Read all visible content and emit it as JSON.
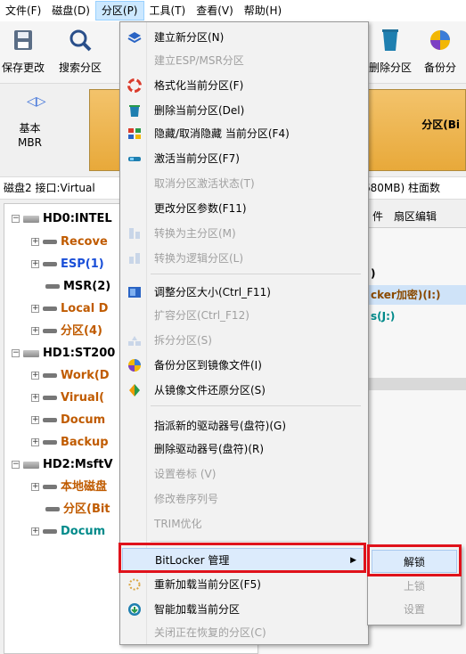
{
  "menubar": {
    "items": [
      {
        "label": "文件(F)"
      },
      {
        "label": "磁盘(D)"
      },
      {
        "label": "分区(P)"
      },
      {
        "label": "工具(T)"
      },
      {
        "label": "查看(V)"
      },
      {
        "label": "帮助(H)"
      }
    ]
  },
  "toolbar": {
    "save": "保存更改",
    "search": "搜索分区",
    "delete": "删除分区",
    "backup": "备份分"
  },
  "disk": {
    "type_line1": "基本",
    "type_line2": "MBR",
    "partition_label": "分区(Bi",
    "info_left": "磁盘2 接口:Virtual",
    "info_right": "680MB) 柱面数"
  },
  "tree": {
    "hd0": "HD0:INTEL",
    "recovery": "Recove",
    "esp": "ESP(1)",
    "msr": "MSR(2)",
    "local": "Local D",
    "part4": "分区(4)",
    "hd1": "HD1:ST200",
    "work": "Work(D",
    "virual": "Virual(",
    "docum1": "Docum",
    "backup": "Backup",
    "hd2": "HD2:MsftV",
    "local_disk": "本地磁盘",
    "part_bit": "分区(Bit",
    "docum2": "Docum"
  },
  "right_panel": {
    "tab1": "件",
    "tab2": "扇区编辑",
    "row1": ")",
    "row2": "cker加密)(I:)",
    "row3": "s(J:)"
  },
  "partition_menu": {
    "items": [
      {
        "label": "建立新分区(N)",
        "enabled": true
      },
      {
        "label": "建立ESP/MSR分区",
        "enabled": false
      },
      {
        "label": "格式化当前分区(F)",
        "enabled": true
      },
      {
        "label": "删除当前分区(Del)",
        "enabled": true
      },
      {
        "label": "隐藏/取消隐藏 当前分区(F4)",
        "enabled": true
      },
      {
        "label": "激活当前分区(F7)",
        "enabled": true
      },
      {
        "label": "取消分区激活状态(T)",
        "enabled": false
      },
      {
        "label": "更改分区参数(F11)",
        "enabled": true
      },
      {
        "label": "转换为主分区(M)",
        "enabled": false
      },
      {
        "label": "转换为逻辑分区(L)",
        "enabled": false
      },
      {
        "label": "调整分区大小(Ctrl_F11)",
        "enabled": true
      },
      {
        "label": "扩容分区(Ctrl_F12)",
        "enabled": false
      },
      {
        "label": "拆分分区(S)",
        "enabled": false
      },
      {
        "label": "备份分区到镜像文件(I)",
        "enabled": true
      },
      {
        "label": "从镜像文件还原分区(S)",
        "enabled": true
      },
      {
        "label": "指派新的驱动器号(盘符)(G)",
        "enabled": true
      },
      {
        "label": "删除驱动器号(盘符)(R)",
        "enabled": true
      },
      {
        "label": "设置卷标 (V)",
        "enabled": false
      },
      {
        "label": "修改卷序列号",
        "enabled": false
      },
      {
        "label": "TRIM优化",
        "enabled": false
      },
      {
        "label": "BitLocker 管理",
        "enabled": true
      },
      {
        "label": "重新加载当前分区(F5)",
        "enabled": true
      },
      {
        "label": "智能加载当前分区",
        "enabled": true
      },
      {
        "label": "关闭正在恢复的分区(C)",
        "enabled": false
      }
    ]
  },
  "bitlocker_submenu": {
    "items": [
      {
        "label": "解锁",
        "enabled": true
      },
      {
        "label": "上锁",
        "enabled": false
      },
      {
        "label": "设置",
        "enabled": false
      }
    ]
  },
  "colors": {
    "highlight": "#dcebfc",
    "callout_red": "#e0121b",
    "partition_orange": "#c05b00",
    "partition_blue": "#1a4fd8",
    "partition_teal": "#008a8a"
  }
}
